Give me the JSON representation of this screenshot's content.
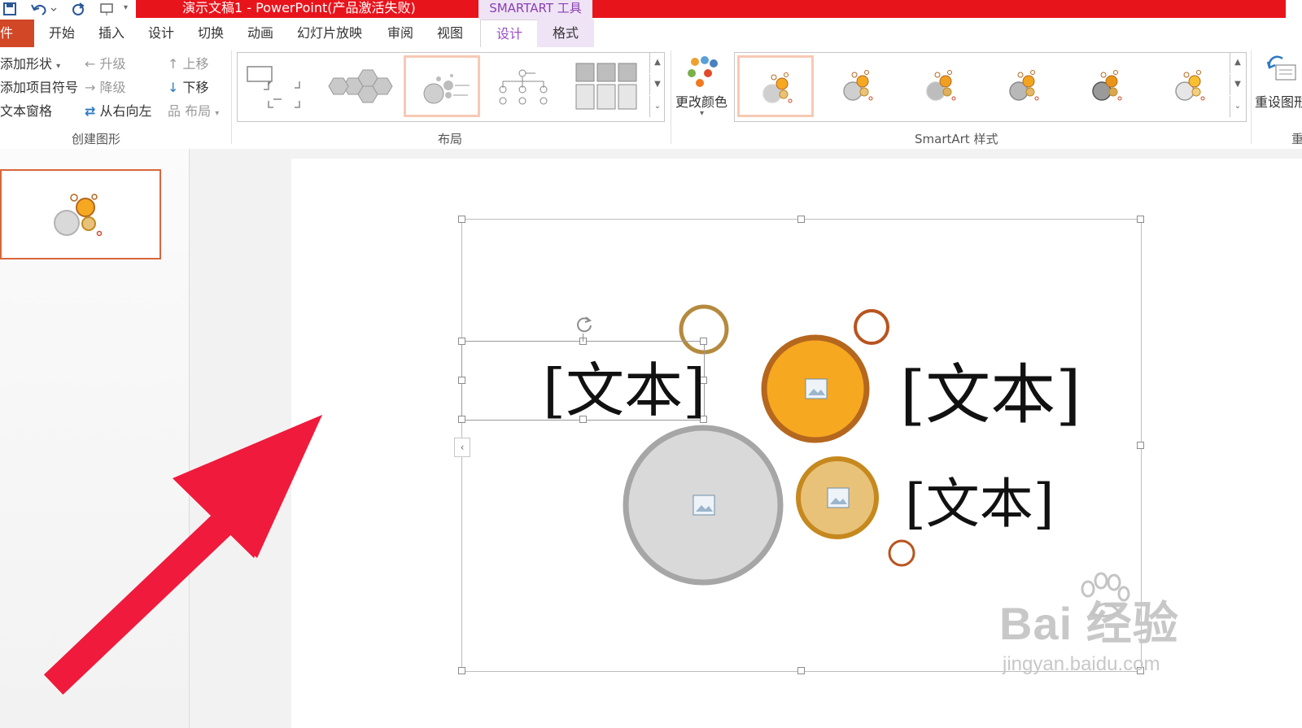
{
  "window": {
    "title": "演示文稿1 - PowerPoint(产品激活失败)",
    "context_tab_group": "SMARTART 工具",
    "accent_red": "#e8141c",
    "file_color": "#d24726",
    "context_color": "#9a4ec8"
  },
  "tabs": [
    "开始",
    "插入",
    "设计",
    "切换",
    "动画",
    "幻灯片放映",
    "审阅",
    "视图"
  ],
  "file_tab": "件",
  "context_tabs": {
    "design": "设计",
    "format": "格式"
  },
  "create_graphic": {
    "add_shape": "添加形状",
    "add_bullet": "添加项目符号",
    "text_pane": "文本窗格",
    "promote": "升级",
    "demote": "降级",
    "right_to_left": "从右向左",
    "move_up": "上移",
    "move_down": "下移",
    "layout": "布局",
    "group_label": "创建图形"
  },
  "layouts": {
    "group_label": "布局"
  },
  "styles": {
    "change_colors": "更改颜色",
    "group_label": "SmartArt 样式"
  },
  "reset": {
    "label": "重设图形",
    "group_label": "重"
  },
  "slide": {
    "text_1": "[文本]",
    "text_2": "[文本]",
    "text_3": "[文本]",
    "colors": {
      "orange": "#f6a821",
      "gray": "#d9d9d9",
      "tan": "#e9c27a",
      "brown": "#b5671e"
    }
  },
  "watermark": {
    "main": "Bai  经验",
    "sub": "jingyan.baidu.com"
  }
}
